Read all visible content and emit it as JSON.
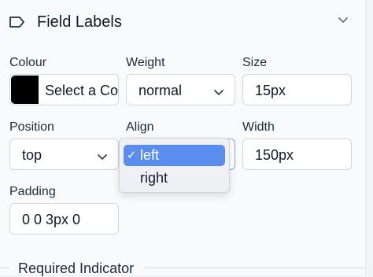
{
  "header": {
    "title": "Field Labels",
    "icon": "tag-icon",
    "collapse_icon": "chevron-down-icon"
  },
  "fields": {
    "colour": {
      "label": "Colour",
      "swatch_color": "#000000",
      "value": "Select a Co"
    },
    "weight": {
      "label": "Weight",
      "value": "normal"
    },
    "size": {
      "label": "Size",
      "value": "15px"
    },
    "position": {
      "label": "Position",
      "value": "top"
    },
    "align": {
      "label": "Align",
      "options": [
        {
          "label": "left",
          "selected": true
        },
        {
          "label": "right",
          "selected": false
        }
      ],
      "checkmark": "✓"
    },
    "width": {
      "label": "Width",
      "value": "150px"
    },
    "padding": {
      "label": "Padding",
      "value": "0 0 3px 0"
    }
  },
  "next_section": {
    "title": "Required Indicator"
  },
  "colors": {
    "selected_option_bg": "#5b8def",
    "panel_bg": "#f9fafb",
    "border": "#d1d5db"
  }
}
